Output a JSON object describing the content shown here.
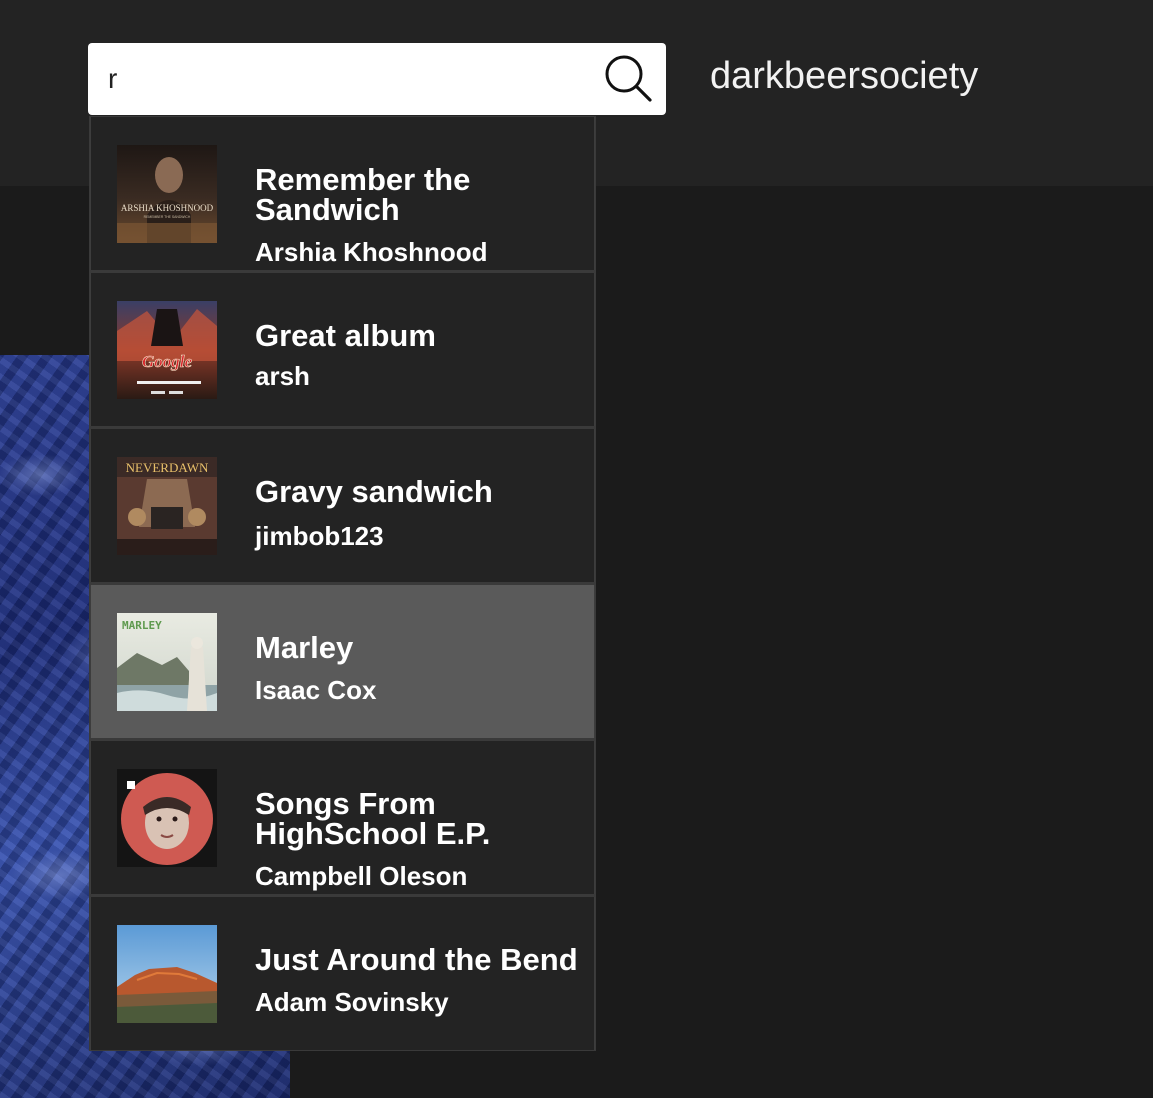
{
  "header": {
    "search": {
      "value": "r",
      "placeholder": ""
    },
    "site_name": "darkbeersociety"
  },
  "results": [
    {
      "title": "Remember the Sandwich",
      "artist": "Arshia Khoshnood",
      "cover_text": "ARSHIA KHOSHNOOD",
      "cover_subtext": "REMEMBER THE SANDWICH"
    },
    {
      "title": "Great album",
      "artist": "arsh",
      "cover_text": "Google"
    },
    {
      "title": "Gravy sandwich",
      "artist": "jimbob123",
      "cover_text": "NEVERDAWN"
    },
    {
      "title": "Marley",
      "artist": "Isaac Cox",
      "cover_text": "MARLEY",
      "highlighted": true
    },
    {
      "title": "Songs From HighSchool E.P.",
      "artist": "Campbell Oleson"
    },
    {
      "title": "Just Around the Bend",
      "artist": "Adam Sovinsky"
    }
  ],
  "colors": {
    "topbar": "#232323",
    "page_background": "#1b1b1b",
    "result_background": "#232323",
    "result_highlight": "#5a5a5a",
    "text": "#ffffff"
  }
}
